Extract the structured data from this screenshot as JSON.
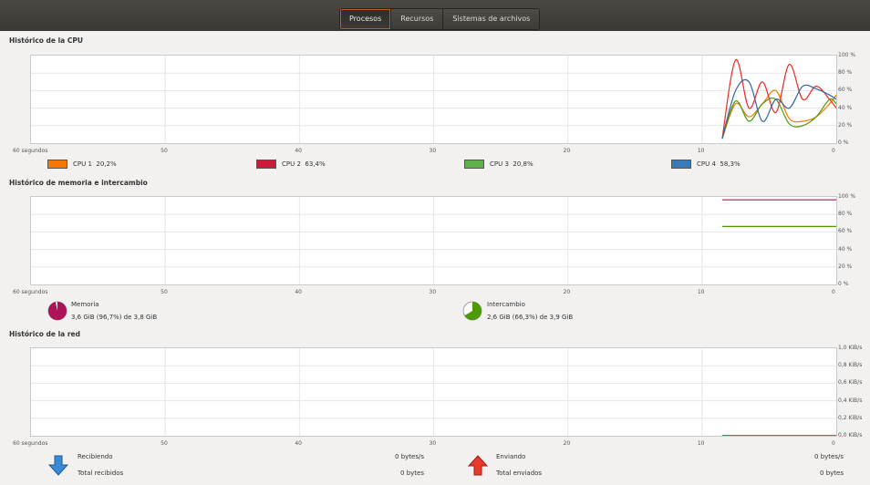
{
  "tabs": [
    {
      "label": "Procesos",
      "active": true
    },
    {
      "label": "Recursos",
      "active": false
    },
    {
      "label": "Sistemas de archivos",
      "active": false
    }
  ],
  "cpu": {
    "title": "Histórico de la CPU",
    "y_ticks": [
      "100 %",
      "80 %",
      "60 %",
      "40 %",
      "20 %",
      "0 %"
    ],
    "legend": [
      {
        "name": "CPU 1",
        "value": "20,2%",
        "color": "#f57900"
      },
      {
        "name": "CPU 2",
        "value": "63,4%",
        "color": "#ef2929"
      },
      {
        "name": "CPU 3",
        "value": "20,8%",
        "color": "#4e9a06"
      },
      {
        "name": "CPU 4",
        "value": "58,3%",
        "color": "#3465a4"
      }
    ]
  },
  "memory": {
    "title": "Histórico de memoria e intercambio",
    "y_ticks": [
      "100 %",
      "80 %",
      "60 %",
      "40 %",
      "20 %",
      "0 %"
    ],
    "memoria_label": "Memoria",
    "memoria_value": "3,6 GiB (96,7%) de 3,8 GiB",
    "memoria_fraction": 0.967,
    "memoria_color": "#ad1457",
    "intercambio_label": "Intercambio",
    "intercambio_value": "2,6 GiB (66,3%) de 3,9 GiB",
    "intercambio_fraction": 0.663,
    "intercambio_color": "#4e9a06"
  },
  "network": {
    "title": "Histórico de la red",
    "y_ticks": [
      "1,0 KiB/s",
      "0,8 KiB/s",
      "0,6 KiB/s",
      "0,4 KiB/s",
      "0,2 KiB/s",
      "0,0 KiB/s"
    ],
    "recibiendo_label": "Recibiendo",
    "recibiendo_value": "0 bytes/s",
    "total_recibidos_label": "Total recibidos",
    "total_recibidos_value": "0 bytes",
    "enviando_label": "Enviando",
    "enviando_value": "0 bytes/s",
    "total_enviados_label": "Total enviados",
    "total_enviados_value": "0 bytes"
  },
  "x_axis": {
    "first_label": "60 segundos",
    "labels": [
      "50",
      "40",
      "30",
      "20",
      "10",
      "0"
    ]
  },
  "chart_data": [
    {
      "type": "line",
      "title": "Histórico de la CPU",
      "xlim": [
        60,
        0
      ],
      "ylim": [
        0,
        100
      ],
      "x": [
        8.5,
        7.5,
        6.5,
        5.5,
        4.5,
        3.5,
        2.5,
        1.5,
        0.5,
        0
      ],
      "series": [
        {
          "name": "CPU 1",
          "color": "#f57900",
          "values": [
            5,
            45,
            30,
            45,
            60,
            28,
            25,
            30,
            45,
            55
          ]
        },
        {
          "name": "CPU 2",
          "color": "#ef2929",
          "values": [
            5,
            95,
            40,
            70,
            35,
            90,
            50,
            65,
            50,
            40
          ]
        },
        {
          "name": "CPU 3",
          "color": "#4e9a06",
          "values": [
            5,
            48,
            25,
            45,
            50,
            22,
            20,
            30,
            50,
            45
          ]
        },
        {
          "name": "CPU 4",
          "color": "#3465a4",
          "values": [
            5,
            60,
            70,
            25,
            50,
            40,
            65,
            62,
            55,
            50
          ]
        }
      ]
    },
    {
      "type": "line",
      "title": "Histórico de memoria e intercambio",
      "xlim": [
        60,
        0
      ],
      "ylim": [
        0,
        100
      ],
      "x": [
        8.5,
        0
      ],
      "series": [
        {
          "name": "Memoria",
          "color": "#ad1457",
          "values": [
            96.7,
            96.7
          ]
        },
        {
          "name": "Intercambio",
          "color": "#4e9a06",
          "values": [
            66.3,
            66.3
          ]
        }
      ]
    },
    {
      "type": "line",
      "title": "Histórico de la red",
      "xlim": [
        60,
        0
      ],
      "ylim": [
        0,
        1.0
      ],
      "x": [
        8.5,
        0
      ],
      "series": [
        {
          "name": "Recibiendo",
          "color": "#3465a4",
          "values": [
            0,
            0
          ]
        },
        {
          "name": "Enviando",
          "color": "#cc0000",
          "values": [
            0,
            0
          ]
        }
      ]
    }
  ]
}
